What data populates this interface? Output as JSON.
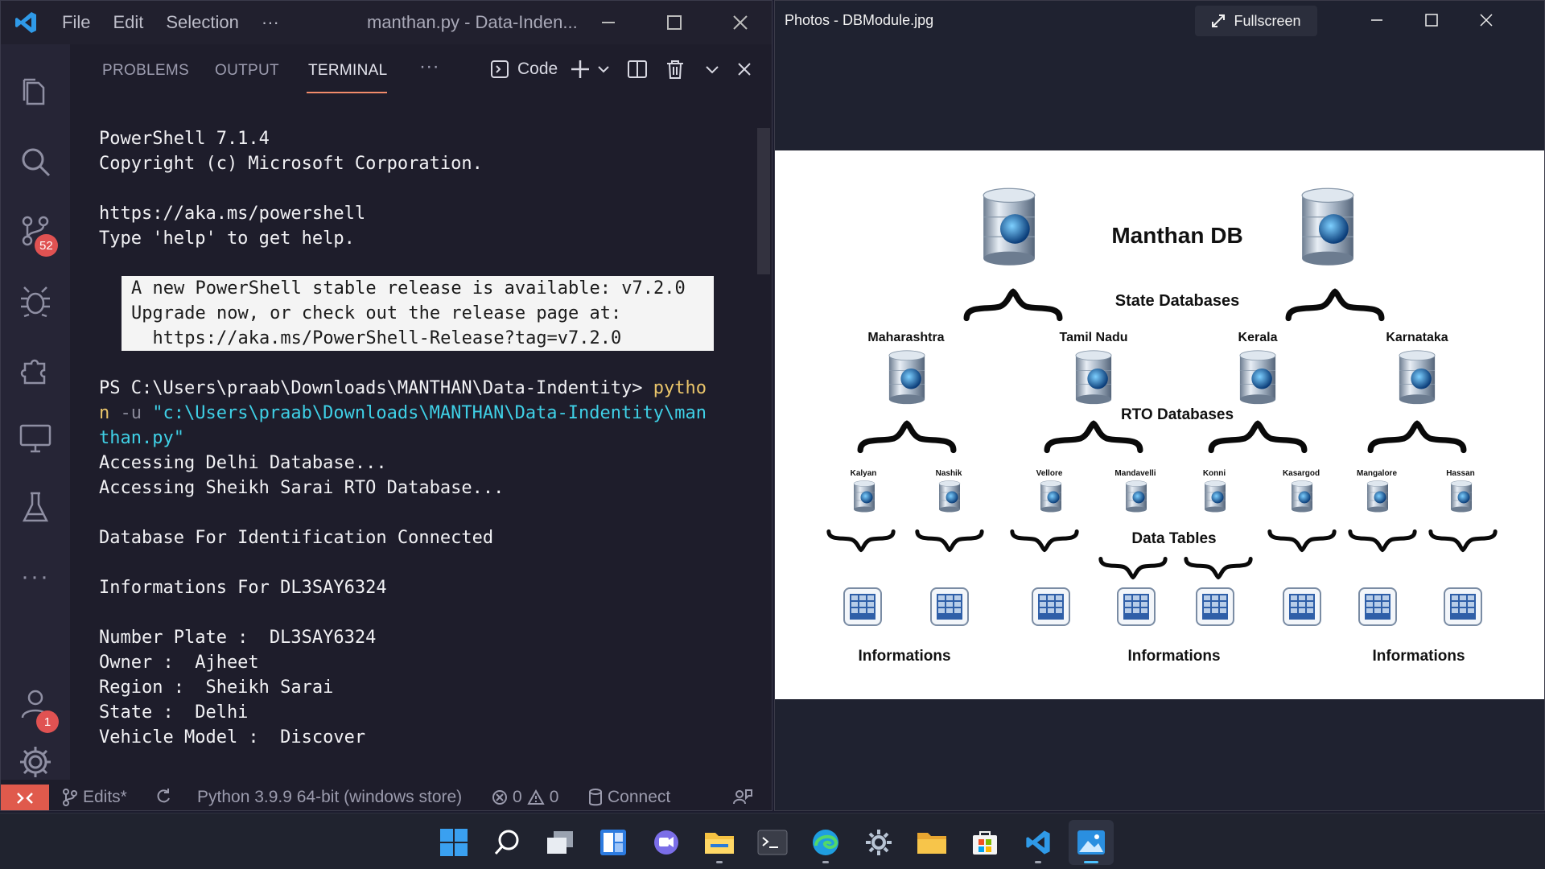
{
  "vscode": {
    "menu": [
      "File",
      "Edit",
      "Selection",
      "···"
    ],
    "title": "manthan.py - Data-Inden...",
    "activity_badges": {
      "source_control": "52",
      "accounts": "1"
    },
    "panel": {
      "tabs": [
        "PROBLEMS",
        "OUTPUT",
        "TERMINAL"
      ],
      "active_tab": "TERMINAL",
      "more": "···",
      "terminal_name": "Code"
    },
    "terminal": {
      "l1": "PowerShell 7.1.4",
      "l2": "Copyright (c) Microsoft Corporation.",
      "l3": "https://aka.ms/powershell",
      "l4": "Type 'help' to get help.",
      "n1": "A new PowerShell stable release is available: v7.2.0",
      "n2": "Upgrade now, or check out the release page at:",
      "n3": "  https://aka.ms/PowerShell-Release?tag=v7.2.0",
      "prompt": "PS C:\\Users\\praab\\Downloads\\MANTHAN\\Data-Indentity> ",
      "cmd1": "pytho",
      "cmd2": "n",
      "flag": " -u ",
      "path1": "\"c:\\Users\\praab\\Downloads\\MANTHAN\\Data-Indentity\\man",
      "path2": "than.py\"",
      "o1": "Accessing Delhi Database...",
      "o2": "Accessing Sheikh Sarai RTO Database...",
      "o3": "Database For Identification Connected",
      "o4": "Informations For DL3SAY6324",
      "o5": "Number Plate :  DL3SAY6324",
      "o6": "Owner :  Ajheet",
      "o7": "Region :  Sheikh Sarai",
      "o8": "State :  Delhi",
      "o9": "Vehicle Model :  Discover"
    },
    "status": {
      "branch": "Edits*",
      "python": "Python 3.9.9 64-bit (windows store)",
      "errors": "0",
      "warnings": "0",
      "connect": "Connect"
    }
  },
  "photos": {
    "title": "Photos - DBModule.jpg",
    "fullscreen": "Fullscreen",
    "diagram": {
      "title": "Manthan DB",
      "state_label": "State Databases",
      "rto_label": "RTO Databases",
      "tables_label": "Data Tables",
      "states": [
        "Maharashtra",
        "Tamil Nadu",
        "Kerala",
        "Karnataka"
      ],
      "rtos": [
        "Kalyan",
        "Nashik",
        "Vellore",
        "Mandavelli",
        "Konni",
        "Kasargod",
        "Mangalore",
        "Hassan"
      ],
      "info": [
        "Informations",
        "Informations",
        "Informations"
      ]
    }
  },
  "colors": {
    "accent_orange": "#f28b6a",
    "terminal_yellow": "#e9c46a",
    "terminal_cyan": "#3fd0e6",
    "badge_red": "#e05252"
  }
}
